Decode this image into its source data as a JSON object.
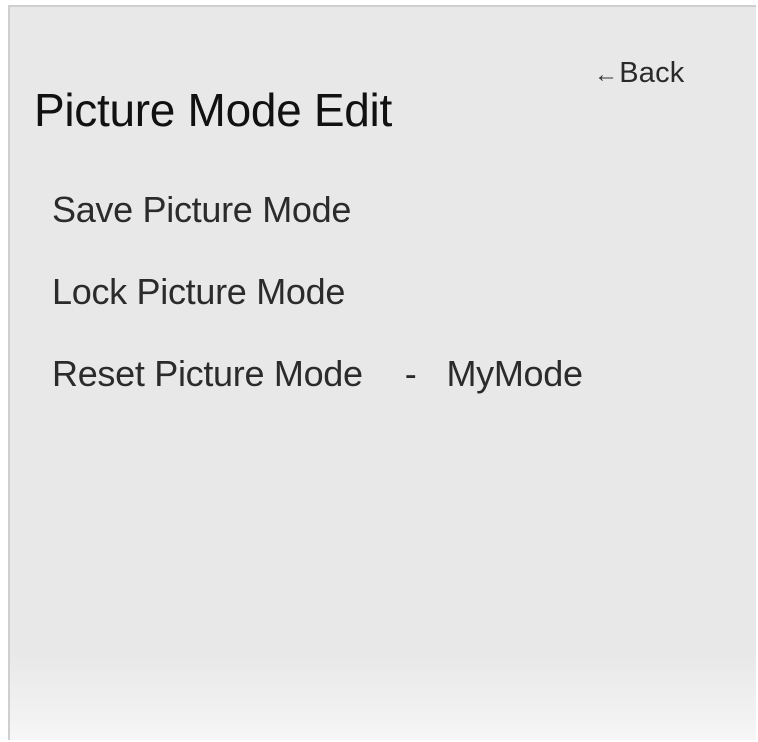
{
  "header": {
    "back_arrow": "←",
    "back_label": "Back",
    "title": "Picture Mode Edit"
  },
  "menu": {
    "items": [
      {
        "label": "Save Picture Mode"
      },
      {
        "label": "Lock Picture Mode"
      },
      {
        "label": "Reset Picture Mode",
        "separator": "-",
        "value": "MyMode"
      }
    ]
  },
  "colors": {
    "panel_background": "#e8e8e8",
    "text": "#2b2b2b",
    "title_text": "#111111"
  },
  "icons": {
    "back": "left-arrow-icon"
  }
}
